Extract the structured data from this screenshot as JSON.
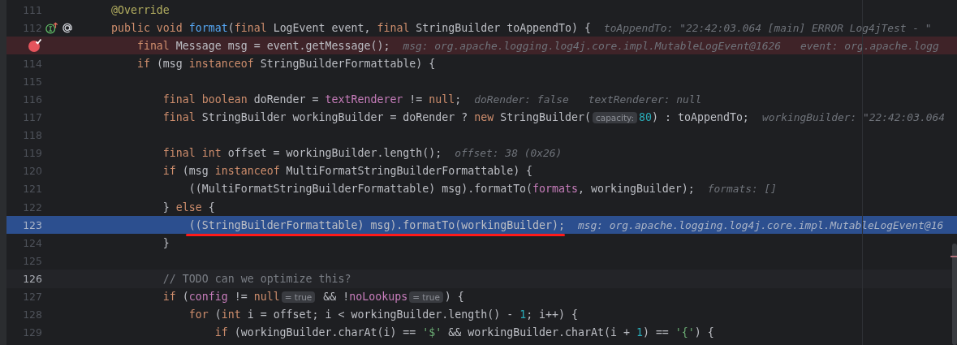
{
  "editor": {
    "lines": [
      {
        "number": "111",
        "tokens": [
          {
            "kind": "annotation",
            "text": "    @Override"
          }
        ]
      },
      {
        "number": "112",
        "implementation_marker": true,
        "annotation_marker": true,
        "tokens": [
          {
            "kind": "keyword",
            "text": "    public void "
          },
          {
            "kind": "function",
            "text": "format"
          },
          {
            "kind": "plain",
            "text": "("
          },
          {
            "kind": "keyword",
            "text": "final "
          },
          {
            "kind": "plain",
            "text": "LogEvent event, "
          },
          {
            "kind": "keyword",
            "text": "final "
          },
          {
            "kind": "plain",
            "text": "StringBuilder toAppendTo) {"
          }
        ],
        "hints": [
          "toAppendTo: \"22:42:03.064 [main] ERROR Log4jTest - \""
        ]
      },
      {
        "breakpoint": true,
        "tokens": [
          {
            "kind": "keyword",
            "text": "        final "
          },
          {
            "kind": "plain",
            "text": "Message msg = event.getMessage();"
          }
        ],
        "hints": [
          "msg: org.apache.logging.log4j.core.impl.MutableLogEvent@1626",
          "event: org.apache.logg"
        ]
      },
      {
        "number": "114",
        "tokens": [
          {
            "kind": "keyword",
            "text": "        if "
          },
          {
            "kind": "plain",
            "text": "(msg "
          },
          {
            "kind": "keyword",
            "text": "instanceof "
          },
          {
            "kind": "plain",
            "text": "StringBuilderFormattable) {"
          }
        ]
      },
      {
        "number": "115"
      },
      {
        "number": "116",
        "tokens": [
          {
            "kind": "keyword",
            "text": "            final boolean "
          },
          {
            "kind": "plain",
            "text": "doRender = "
          },
          {
            "kind": "field",
            "text": "textRenderer"
          },
          {
            "kind": "plain",
            "text": " != "
          },
          {
            "kind": "keyword",
            "text": "null"
          },
          {
            "kind": "plain",
            "text": ";"
          }
        ],
        "hints": [
          "doRender: false",
          "textRenderer: null"
        ]
      },
      {
        "number": "117",
        "tokens": [
          {
            "kind": "keyword",
            "text": "            final "
          },
          {
            "kind": "plain",
            "text": "StringBuilder workingBuilder = doRender ? "
          },
          {
            "kind": "keyword",
            "text": "new "
          },
          {
            "kind": "plain",
            "text": "StringBuilder("
          },
          {
            "kind": "badge",
            "text": "capacity:"
          },
          {
            "kind": "number",
            "text": "80"
          },
          {
            "kind": "plain",
            "text": ") : toAppendTo;"
          }
        ],
        "hints": [
          "workingBuilder: \"22:42:03.064"
        ]
      },
      {
        "number": "118"
      },
      {
        "number": "119",
        "tokens": [
          {
            "kind": "keyword",
            "text": "            final int "
          },
          {
            "kind": "plain",
            "text": "offset = workingBuilder.length();"
          }
        ],
        "hints": [
          "offset: 38 (0x26)"
        ]
      },
      {
        "number": "120",
        "tokens": [
          {
            "kind": "keyword",
            "text": "            if "
          },
          {
            "kind": "plain",
            "text": "(msg "
          },
          {
            "kind": "keyword",
            "text": "instanceof "
          },
          {
            "kind": "plain",
            "text": "MultiFormatStringBuilderFormattable) {"
          }
        ]
      },
      {
        "number": "121",
        "tokens": [
          {
            "kind": "plain",
            "text": "                ((MultiFormatStringBuilderFormattable) msg).formatTo("
          },
          {
            "kind": "field",
            "text": "formats"
          },
          {
            "kind": "plain",
            "text": ", workingBuilder);"
          }
        ],
        "hints": [
          "formats: []"
        ]
      },
      {
        "number": "122",
        "tokens": [
          {
            "kind": "plain",
            "text": "            } "
          },
          {
            "kind": "keyword",
            "text": "else "
          },
          {
            "kind": "plain",
            "text": "{"
          }
        ]
      },
      {
        "number": "123",
        "execution_point": true,
        "underlined": true,
        "tokens": [
          {
            "kind": "plain",
            "text": "                ((StringBuilderFormattable) msg).formatTo(workingBuilder);"
          }
        ],
        "hints": [
          "msg: org.apache.logging.log4j.core.impl.MutableLogEvent@16"
        ]
      },
      {
        "number": "124",
        "tokens": [
          {
            "kind": "plain",
            "text": "            }"
          }
        ]
      },
      {
        "number": "125"
      },
      {
        "number": "126",
        "caret_line": true,
        "tokens": [
          {
            "kind": "comment",
            "text": "            // TODO can we optimize this?"
          }
        ]
      },
      {
        "number": "127",
        "tokens": [
          {
            "kind": "keyword",
            "text": "            if "
          },
          {
            "kind": "plain",
            "text": "("
          },
          {
            "kind": "field",
            "text": "config"
          },
          {
            "kind": "plain",
            "text": " != "
          },
          {
            "kind": "keyword",
            "text": "null"
          },
          {
            "kind": "badge",
            "text": "= true"
          },
          {
            "kind": "plain",
            "text": " && !"
          },
          {
            "kind": "field",
            "text": "noLookups"
          },
          {
            "kind": "badge",
            "text": "= true"
          },
          {
            "kind": "plain",
            "text": ") {"
          }
        ]
      },
      {
        "number": "128",
        "tokens": [
          {
            "kind": "keyword",
            "text": "                for "
          },
          {
            "kind": "plain",
            "text": "("
          },
          {
            "kind": "keyword",
            "text": "int "
          },
          {
            "kind": "plain",
            "text": "i = offset; i < workingBuilder.length() - "
          },
          {
            "kind": "number",
            "text": "1"
          },
          {
            "kind": "plain",
            "text": "; i++) {"
          }
        ]
      },
      {
        "number": "129",
        "tokens": [
          {
            "kind": "keyword",
            "text": "                    if "
          },
          {
            "kind": "plain",
            "text": "(workingBuilder.charAt(i) == "
          },
          {
            "kind": "string",
            "text": "'$'"
          },
          {
            "kind": "plain",
            "text": " && workingBuilder.charAt(i + "
          },
          {
            "kind": "number",
            "text": "1"
          },
          {
            "kind": "plain",
            "text": ") == "
          },
          {
            "kind": "string",
            "text": "'{'"
          },
          {
            "kind": "plain",
            "text": ") {"
          }
        ]
      }
    ]
  }
}
